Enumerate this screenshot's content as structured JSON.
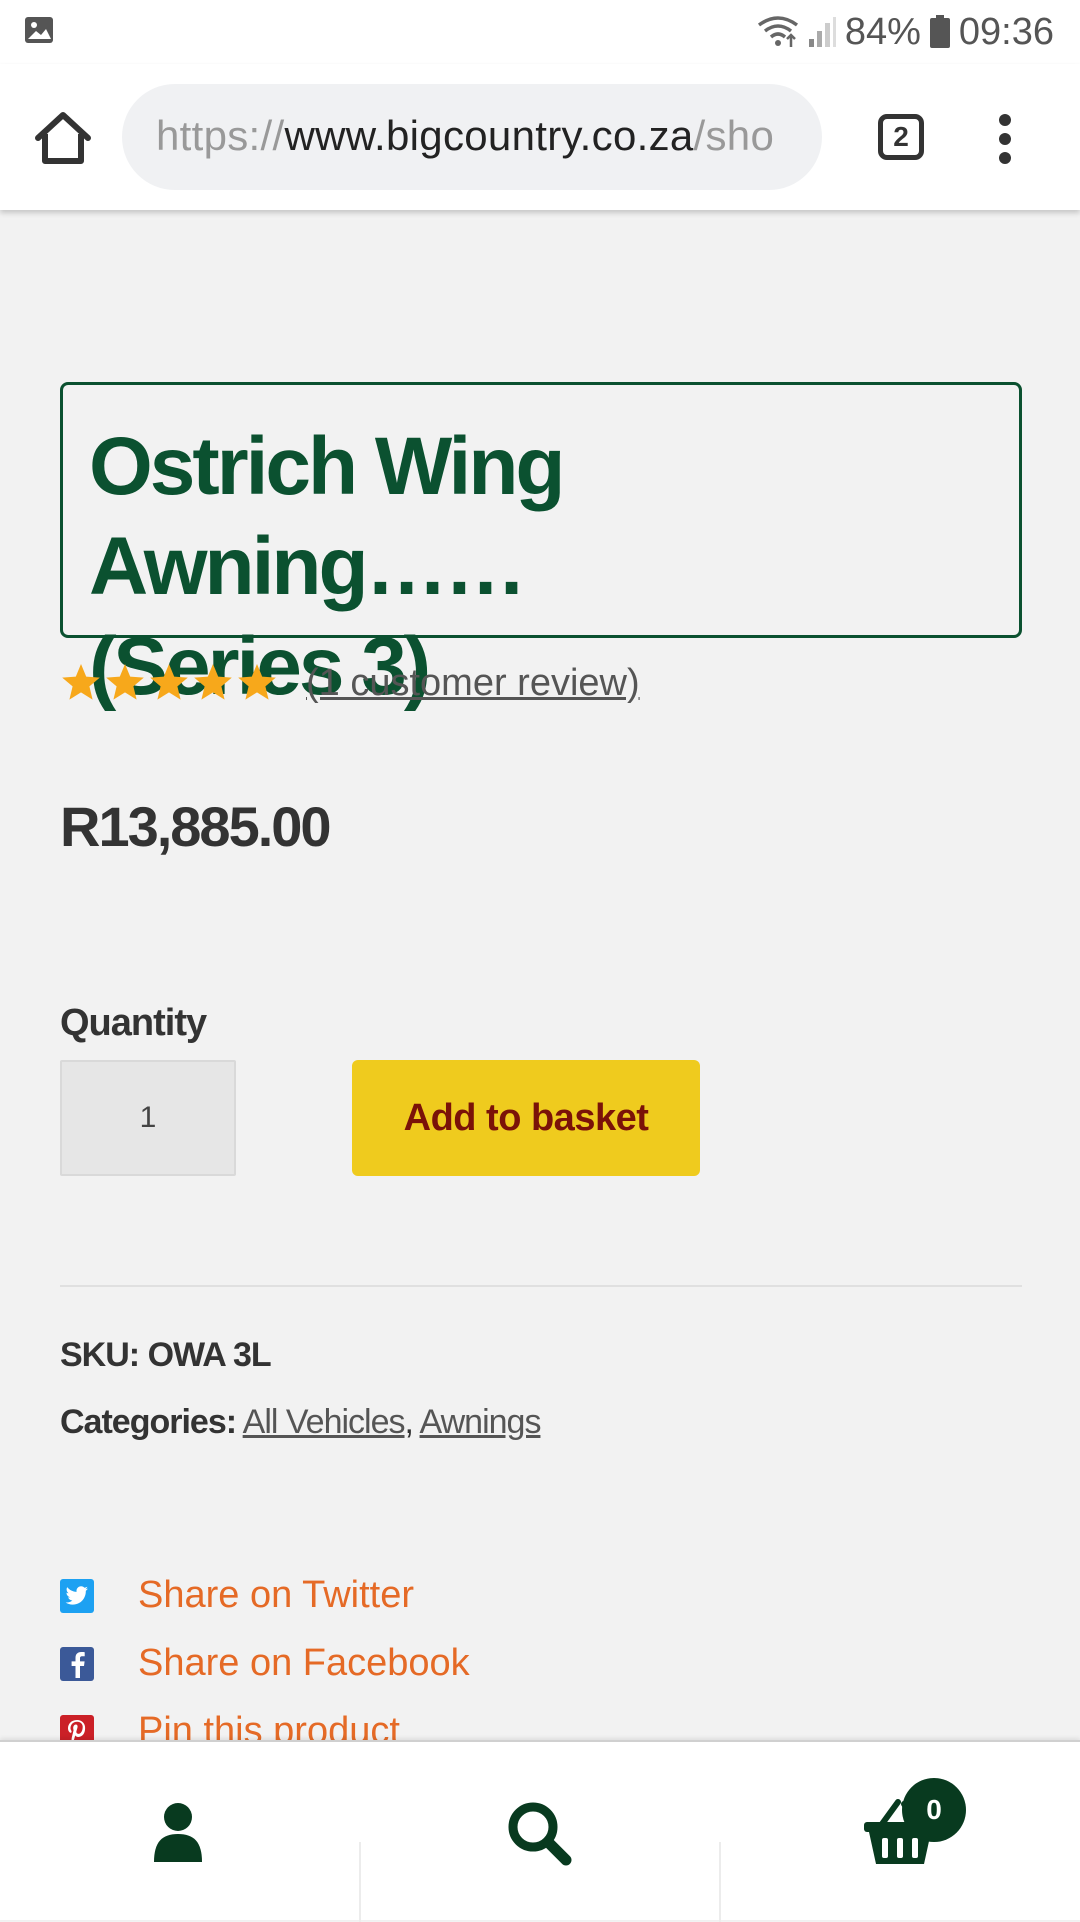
{
  "status_bar": {
    "battery": "84%",
    "time": "09:36"
  },
  "browser": {
    "url_scheme": "https://",
    "url_host": "www.bigcountry.co.za",
    "url_path": "/sho",
    "tab_count": "2"
  },
  "product": {
    "title_line1": "Ostrich Wing Awning……",
    "title_line2": "(Series 3)",
    "rating": 5,
    "rating_max": 5,
    "review_link": "(1 customer review)",
    "price": "R13,885.00",
    "quantity_label": "Quantity",
    "quantity_value": "1",
    "add_to_basket": "Add to basket",
    "sku_label": "SKU:",
    "sku_value": "OWA 3L",
    "categories_label": "Categories:",
    "category_1": "All Vehicles",
    "category_sep": ",",
    "category_2": "Awnings"
  },
  "share": {
    "twitter": "Share on Twitter",
    "facebook": "Share on Facebook",
    "pinterest": "Pin this product"
  },
  "bottom_nav": {
    "cart_count": "0"
  },
  "colors": {
    "brand_green": "#0b5130",
    "button_yellow": "#efcb1e",
    "button_text": "#7a1208",
    "share_orange": "#e56a26",
    "star": "#f7a81b",
    "twitter": "#1da1f2",
    "facebook": "#3b5998",
    "pinterest": "#cb2027"
  }
}
